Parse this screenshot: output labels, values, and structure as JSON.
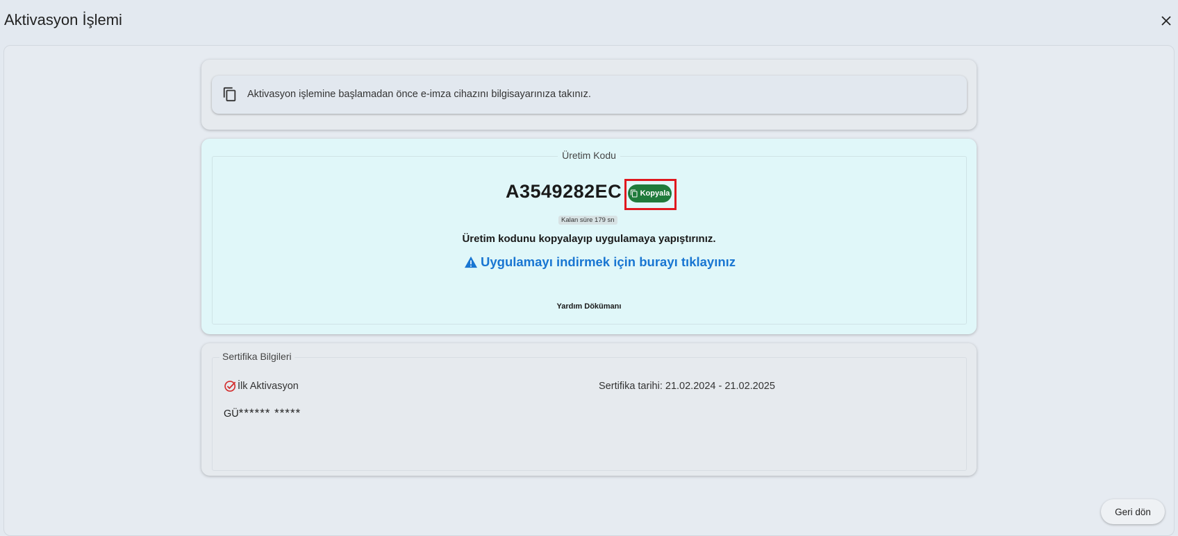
{
  "window": {
    "title": "Aktivasyon İşlemi",
    "close_icon": "close-icon"
  },
  "notice": {
    "icon": "copy-icon",
    "text": "Aktivasyon işlemine başlamadan önce e-imza cihazını bilgisayarınıza takınız."
  },
  "production_code": {
    "legend": "Üretim Kodu",
    "code": "A3549282EC",
    "copy_label": "Kopyala",
    "timer_text": "Kalan süre 179 sn",
    "instruction": "Üretim kodunu kopyalayıp uygulamaya yapıştırınız.",
    "download_link": "Uygulamayı indirmek için burayı tıklayınız",
    "help_doc": "Yardım Dökümanı"
  },
  "certificate": {
    "legend": "Sertifika Bilgileri",
    "activation_label": "İlk Aktivasyon",
    "date_text": "Sertifika tarihi: 21.02.2024 - 21.02.2025",
    "holder_prefix": "GÜ",
    "holder_masked": "****** *****"
  },
  "footer": {
    "back_label": "Geri dön"
  },
  "colors": {
    "accent_blue": "#1976d2",
    "copy_green": "#1f7a3b",
    "highlight_red": "#e0181f",
    "code_card_bg": "#e0f7f9"
  }
}
